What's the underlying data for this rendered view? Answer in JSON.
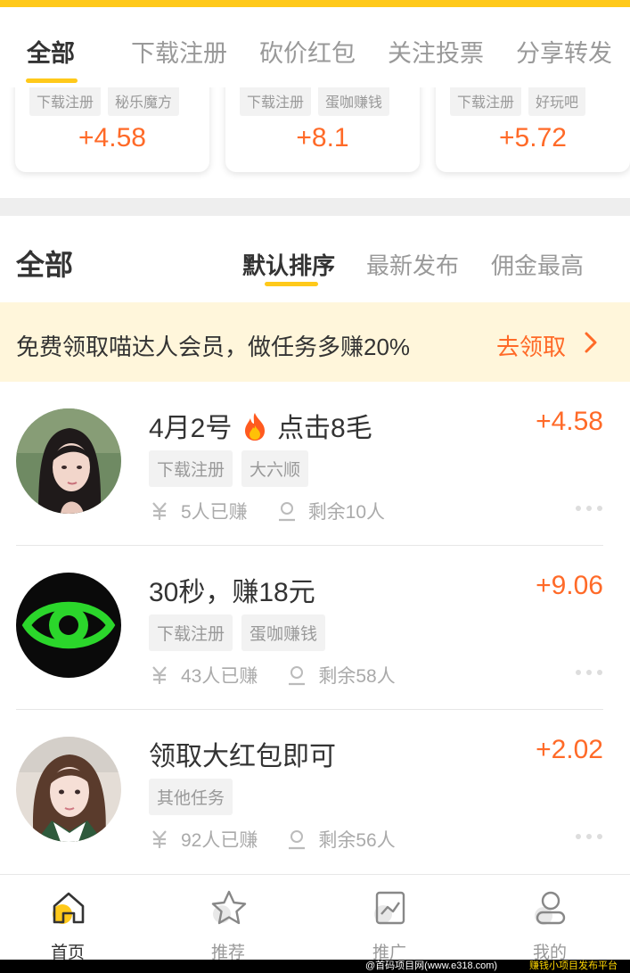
{
  "top_tabs": [
    {
      "label": "全部",
      "active": true
    },
    {
      "label": "下载注册",
      "active": false
    },
    {
      "label": "砍价红包",
      "active": false
    },
    {
      "label": "关注投票",
      "active": false
    },
    {
      "label": "分享转发",
      "active": false
    }
  ],
  "featured_cards": [
    {
      "tags": [
        "下载注册",
        "秘乐魔方"
      ],
      "reward": "+4.58"
    },
    {
      "tags": [
        "下载注册",
        "蛋咖赚钱"
      ],
      "reward": "+8.1"
    },
    {
      "tags": [
        "下载注册",
        "好玩吧"
      ],
      "reward": "+5.72"
    }
  ],
  "list_header": {
    "title": "全部",
    "sorts": [
      {
        "label": "默认排序",
        "active": true
      },
      {
        "label": "最新发布",
        "active": false
      },
      {
        "label": "佣金最高",
        "active": false
      }
    ]
  },
  "banner": {
    "text": "免费领取喵达人会员，做任务多赚20%",
    "cta": "去领取"
  },
  "tasks": [
    {
      "title": "4月2号",
      "title_suffix": "点击8毛",
      "has_fire_icon": true,
      "reward": "+4.58",
      "tags": [
        "下载注册",
        "大六顺"
      ],
      "earned": "5人已赚",
      "remaining": "剩余10人",
      "avatar": "girl-portrait"
    },
    {
      "title": "30秒，赚18元",
      "title_suffix": "",
      "has_fire_icon": false,
      "reward": "+9.06",
      "tags": [
        "下载注册",
        "蛋咖赚钱"
      ],
      "earned": "43人已赚",
      "remaining": "剩余58人",
      "avatar": "green-eye-logo"
    },
    {
      "title": "领取大红包即可",
      "title_suffix": "",
      "has_fire_icon": false,
      "reward": "+2.02",
      "tags": [
        "其他任务"
      ],
      "earned": "92人已赚",
      "remaining": "剩余56人",
      "avatar": "girl-portrait"
    }
  ],
  "bottom_nav": [
    {
      "label": "首页",
      "icon": "home-icon",
      "active": true
    },
    {
      "label": "推荐",
      "icon": "star-icon",
      "active": false
    },
    {
      "label": "推广",
      "icon": "chart-icon",
      "active": false
    },
    {
      "label": "我的",
      "icon": "user-icon",
      "active": false
    }
  ],
  "watermark": {
    "left": "@首码项目网(www.e318.com)",
    "right": "赚钱小项目发布平台"
  },
  "colors": {
    "accent": "#FFC91A",
    "reward": "#FF6A28",
    "banner_bg": "#FFF6DB"
  }
}
